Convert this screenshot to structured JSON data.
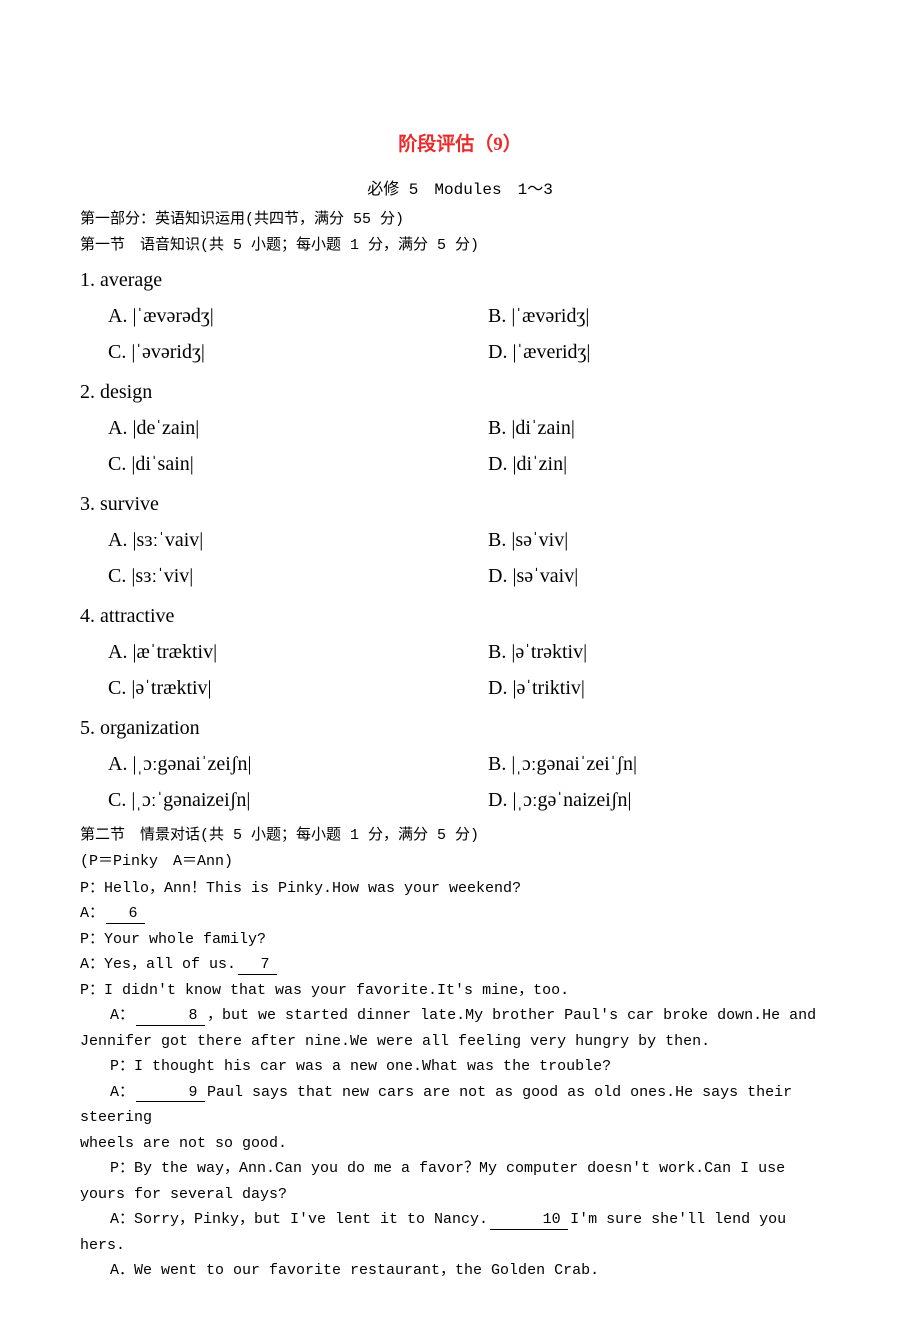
{
  "title": "阶段评估（9）",
  "subtitle": "必修 5　Modules　1～3",
  "part1_hdr": "第一部分：英语知识运用(共四节，满分 55 分)",
  "sec1_hdr": "第一节　语音知识(共 5 小题；每小题 1 分，满分 5 分)",
  "q1": {
    "num": "1. average",
    "A": "A. |ˈævərədʒ|",
    "B": "B. |ˈævəridʒ|",
    "C": "C. |ˈəvəridʒ|",
    "D": "D. |ˈæveridʒ|"
  },
  "q2": {
    "num": "2. design",
    "A": "A. |deˈzain|",
    "B": "B. |diˈzain|",
    "C": "C. |diˈsain|",
    "D": "D. |diˈzin|"
  },
  "q3": {
    "num": "3. survive",
    "A": "A. |sɜːˈvaiv|",
    "B": "B. |səˈviv|",
    "C": "C. |sɜːˈviv|",
    "D": "D. |səˈvaiv|"
  },
  "q4": {
    "num": "4. attractive",
    "A": "A. |æˈtræktiv|",
    "B": "B. |əˈtrəktiv|",
    "C": "C. |əˈtræktiv|",
    "D": "D. |əˈtriktiv|"
  },
  "q5": {
    "num": "5. organization",
    "A": "A. |ˌɔːgənaiˈzeiʃn|",
    "B": "B. |ˌɔːgənaiˈzeiˈʃn|",
    "C": "C. |ˌɔːˈgənaizeiʃn|",
    "D": "D. |ˌɔːgəˈnaizeiʃn|"
  },
  "sec2_hdr": "第二节　情景对话(共 5 小题；每小题 1 分，满分 5 分)",
  "legend": "(P＝Pinky　A＝Ann)",
  "d1": "P：Hello，Ann！This is Pinky.How was your weekend?",
  "d2a": "A：",
  "blank6": "　6　",
  "d3": "P：Your whole family?",
  "d4a": "A：Yes，all of us.",
  "blank7": "　7　",
  "d5": "P：I didn't know that was your favorite.It's mine，too.",
  "d6a": "A：",
  "blank8": "　8　",
  "d6b": "，but we started dinner late.My brother Paul's car broke down.He and",
  "d6c": "Jennifer got there after nine.We were all feeling very hungry by then.",
  "d7": "P：I thought his car was a new one.What was the trouble?",
  "d8a": "A：",
  "blank9": "　9　",
  "d8b": "Paul says that new cars are not as good as old ones.He says their steering",
  "d8c": "wheels are not so good.",
  "d9a": "P：By the way，Ann.Can you do me a favor？My computer doesn't work.Can I use",
  "d9b": "yours for several days?",
  "d10a": "A：Sorry，Pinky，but I've lent it to Nancy.",
  "blank10": "　10　",
  "d10b": "I'm sure she'll lend you",
  "d10c": "hers.",
  "optA": "A．We went to our favorite restaurant，the Golden Crab."
}
